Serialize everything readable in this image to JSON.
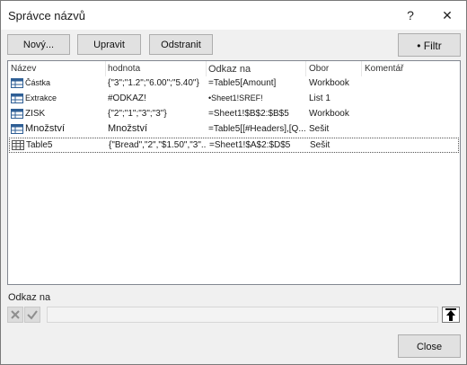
{
  "window": {
    "title": "Správce názvů",
    "help_label": "?",
    "close_label": "✕"
  },
  "toolbar": {
    "new_label": "Nový...",
    "edit_label": "Upravit",
    "delete_label": "Odstranit",
    "filter_label": "• Filtr"
  },
  "columns": [
    "Název",
    "hodnota",
    "Odkaz na",
    "Obor",
    "Komentář"
  ],
  "rows": [
    {
      "name": "Částka",
      "value": "{\"3\";\"1.2\";\"6.00\";\"5.40\"}",
      "refers_to": "=Table5[Amount]",
      "scope": "Workbook",
      "comment": "",
      "icon": "table-name-icon"
    },
    {
      "name": "Extrakce",
      "value": "#ODKAZ!",
      "refers_to": "•Sheet1!SREF!",
      "scope": "List 1",
      "comment": "",
      "icon": "table-name-icon"
    },
    {
      "name": "ZISK",
      "value": "{\"2\";\"1\";\"3\";\"3\"}",
      "refers_to": "=Sheet1!$B$2:$B$5",
      "scope": "Workbook",
      "comment": "",
      "icon": "table-name-icon"
    },
    {
      "name": "Množství",
      "value": "Množství",
      "refers_to": "=Table5[[#Headers],[Q...",
      "scope": "Sešit",
      "comment": "",
      "icon": "table-name-icon"
    },
    {
      "name": "Table5",
      "value": "{\"Bread\",\"2\",\"$1.50\",\"3\"...",
      "refers_to": "=Sheet1!$A$2:$D$5",
      "scope": "Sešit",
      "comment": "",
      "icon": "table-icon"
    }
  ],
  "footer": {
    "refers_to_label": "Odkaz na",
    "refers_to_value": "",
    "close_label": "Close"
  }
}
